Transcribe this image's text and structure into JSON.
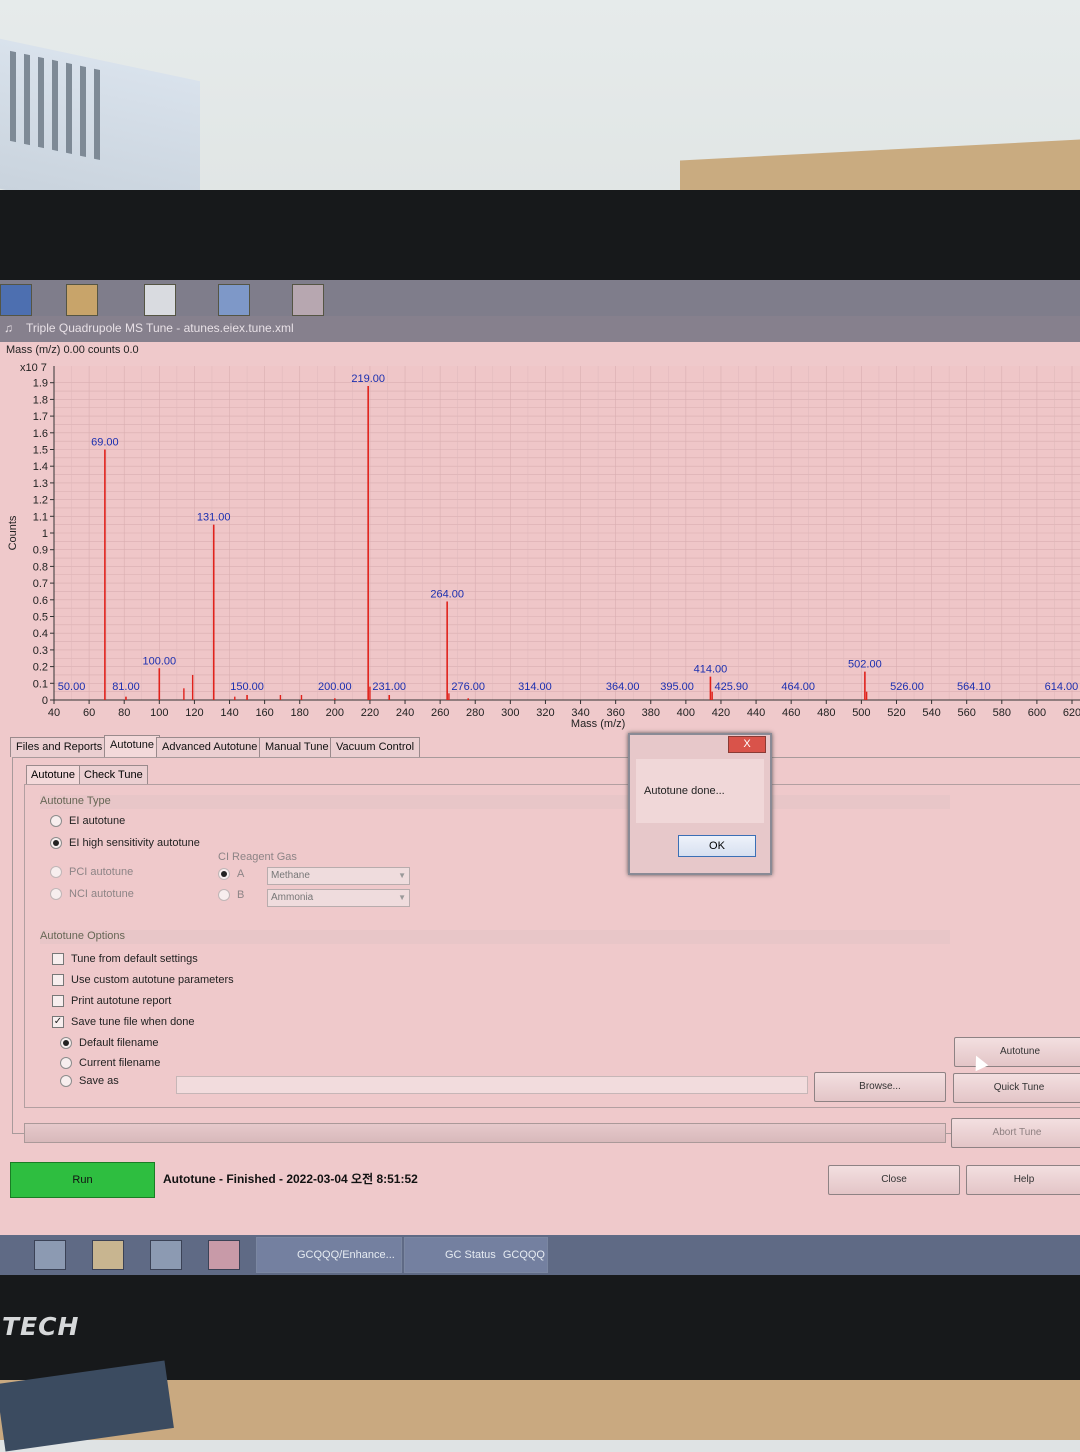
{
  "window": {
    "title": "Triple Quadrupole MS Tune - atunes.eiex.tune.xml"
  },
  "readout": {
    "text": "Mass (m/z) 0.00 counts 0.0",
    "scale": "x10 7"
  },
  "chart_data": {
    "type": "bar",
    "xlabel": "Mass (m/z)",
    "ylabel": "Counts",
    "xlim": [
      40,
      620
    ],
    "ylim": [
      0,
      2.0
    ],
    "x_ticks": [
      "40",
      "60",
      "80",
      "100",
      "120",
      "140",
      "160",
      "180",
      "200",
      "220",
      "240",
      "260",
      "280",
      "300",
      "320",
      "340",
      "360",
      "380",
      "400",
      "420",
      "440",
      "460",
      "480",
      "500",
      "520",
      "540",
      "560",
      "580",
      "600",
      "620"
    ],
    "y_ticks": [
      "0",
      "0.1",
      "0.2",
      "0.3",
      "0.4",
      "0.5",
      "0.6",
      "0.7",
      "0.8",
      "0.9",
      "1",
      "1.1",
      "1.2",
      "1.3",
      "1.4",
      "1.5",
      "1.6",
      "1.7",
      "1.8",
      "1.9"
    ],
    "peaks": [
      {
        "mass": 50,
        "label": "50.00",
        "value": 0.0
      },
      {
        "mass": 69,
        "label": "69.00",
        "value": 1.5
      },
      {
        "mass": 81,
        "label": "81.00",
        "value": 0.02
      },
      {
        "mass": 100,
        "label": "100.00",
        "value": 0.19
      },
      {
        "mass": 131,
        "label": "131.00",
        "value": 1.05
      },
      {
        "mass": 150,
        "label": "150.00",
        "value": 0.03
      },
      {
        "mass": 200,
        "label": "200.00",
        "value": 0.01
      },
      {
        "mass": 219,
        "label": "219.00",
        "value": 1.88
      },
      {
        "mass": 231,
        "label": "231.00",
        "value": 0.03
      },
      {
        "mass": 264,
        "label": "264.00",
        "value": 0.59
      },
      {
        "mass": 276,
        "label": "276.00",
        "value": 0.01
      },
      {
        "mass": 314,
        "label": "314.00",
        "value": 0.0
      },
      {
        "mass": 364,
        "label": "364.00",
        "value": 0.0
      },
      {
        "mass": 395,
        "label": "395.00",
        "value": 0.0
      },
      {
        "mass": 414,
        "label": "414.00",
        "value": 0.14
      },
      {
        "mass": 425.9,
        "label": "425.90",
        "value": 0.0
      },
      {
        "mass": 464,
        "label": "464.00",
        "value": 0.0
      },
      {
        "mass": 502,
        "label": "502.00",
        "value": 0.17
      },
      {
        "mass": 526,
        "label": "526.00",
        "value": 0.0
      },
      {
        "mass": 564.1,
        "label": "564.10",
        "value": 0.0
      },
      {
        "mass": 614,
        "label": "614.00",
        "value": 0.0
      }
    ],
    "minor_peaks": [
      {
        "mass": 114,
        "value": 0.07
      },
      {
        "mass": 119,
        "value": 0.15
      },
      {
        "mass": 143,
        "value": 0.02
      },
      {
        "mass": 169,
        "value": 0.03
      },
      {
        "mass": 181,
        "value": 0.03
      },
      {
        "mass": 220,
        "value": 0.08
      },
      {
        "mass": 265,
        "value": 0.04
      },
      {
        "mass": 415,
        "value": 0.05
      },
      {
        "mass": 503,
        "value": 0.05
      }
    ]
  },
  "tabs": [
    "Files and Reports",
    "Autotune",
    "Advanced Autotune",
    "Manual Tune",
    "Vacuum Control"
  ],
  "subtabs": [
    "Autotune",
    "Check Tune"
  ],
  "autotune_type": {
    "title": "Autotune Type",
    "options": [
      "EI autotune",
      "EI high sensitivity autotune",
      "PCI autotune",
      "NCI autotune"
    ],
    "selected": "EI high sensitivity autotune"
  },
  "ci_gas": {
    "title": "CI Reagent Gas",
    "a_label": "A",
    "b_label": "B",
    "a_value": "Methane",
    "b_value": "Ammonia"
  },
  "autotune_options": {
    "title": "Autotune Options",
    "tune_default": "Tune from default settings",
    "custom_params": "Use custom autotune parameters",
    "print_report": "Print autotune report",
    "save_tune": "Save tune file when done",
    "default_filename": "Default filename",
    "current_filename": "Current filename",
    "save_as": "Save as"
  },
  "buttons": {
    "browse": "Browse...",
    "autotune": "Autotune",
    "quick_tune": "Quick Tune",
    "abort_tune": "Abort Tune",
    "close": "Close",
    "help": "Help",
    "run": "Run"
  },
  "status": "Autotune - Finished - 2022-03-04 오전 8:51:52",
  "dialog": {
    "message": "Autotune done...",
    "ok": "OK",
    "close": "X"
  },
  "taskbar": {
    "task1": "GCQQQ/Enhance...",
    "task2": "GC Status",
    "task2b": "GCQQQ"
  },
  "monitor_brand": "TECH",
  "colors": {
    "peak": "#e0221c",
    "label": "#1b2fb0",
    "run_green": "#2ebe40",
    "screen_bg": "#efc9cb"
  }
}
